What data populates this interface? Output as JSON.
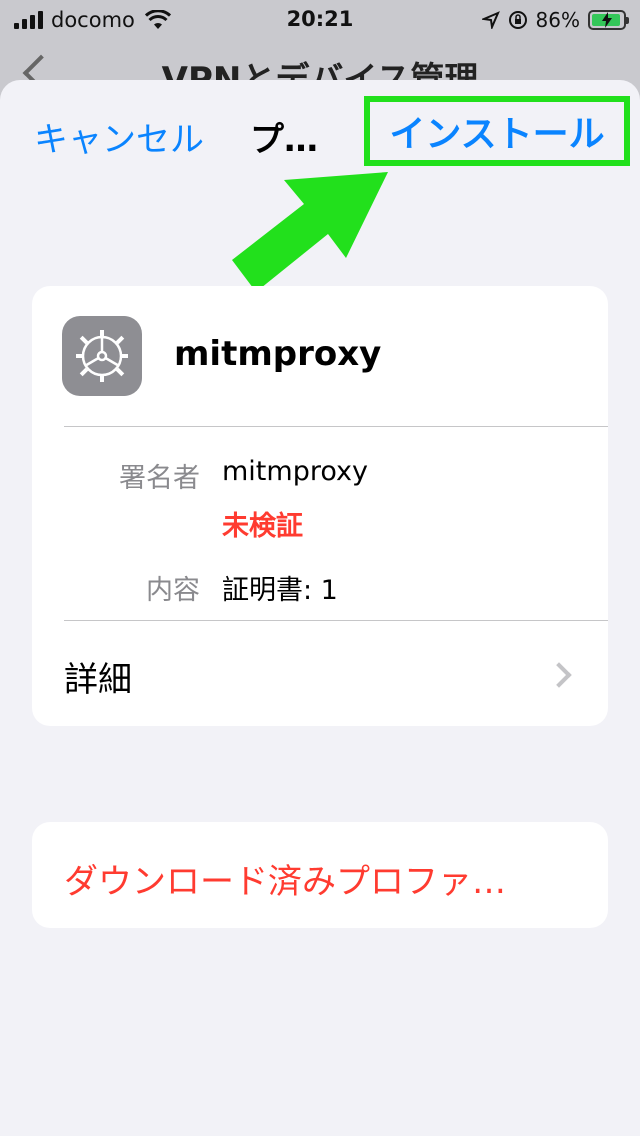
{
  "status": {
    "carrier": "docomo",
    "time": "20:21",
    "battery_pct": "86%"
  },
  "background": {
    "title": "VPNとデバイス管理"
  },
  "nav": {
    "cancel": "キャンセル",
    "title": "プ…",
    "install": "インストール"
  },
  "profile": {
    "name": "mitmproxy",
    "signer_label": "署名者",
    "signer_value": "mitmproxy",
    "signer_status": "未検証",
    "contents_label": "内容",
    "contents_value": "証明書: 1",
    "details_label": "詳細"
  },
  "actions": {
    "remove_label": "ダウンロード済みプロファ…"
  },
  "colors": {
    "accent": "#0a84ff",
    "destructive": "#ff3b30",
    "highlight": "#22e01c"
  }
}
